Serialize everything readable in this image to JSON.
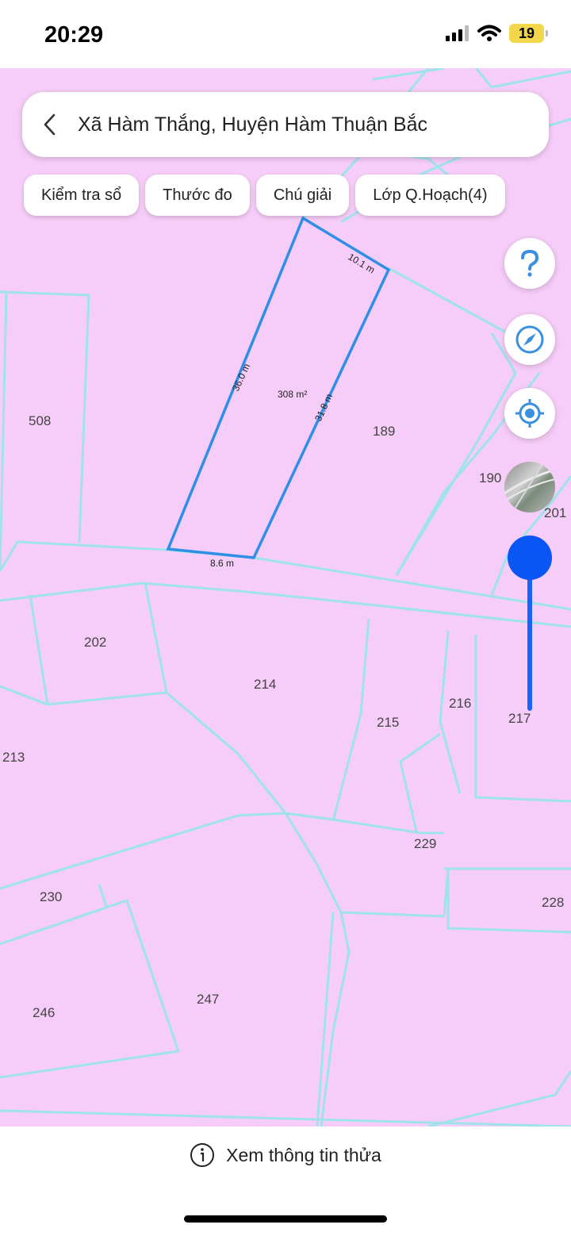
{
  "status": {
    "time": "20:29",
    "battery": "19"
  },
  "search": {
    "title": "Xã Hàm Thắng, Huyện Hàm Thuận Bắc"
  },
  "chips": [
    "Kiểm tra sổ",
    "Thước đo",
    "Chú giải",
    "Lớp Q.Hoạch(4)"
  ],
  "selected_parcel": {
    "area": "308 m²",
    "edges": [
      "10.1 m",
      "31.8 m",
      "8.6 m",
      "36.0 m"
    ]
  },
  "plots": [
    "508",
    "189",
    "190",
    "201",
    "202",
    "214",
    "216",
    "215",
    "217",
    "213",
    "229",
    "230",
    "228",
    "246",
    "247"
  ],
  "bottom": {
    "info_label": "Xem thông tin thửa"
  },
  "icons": [
    "back-icon",
    "help-icon",
    "compass-icon",
    "locate-icon",
    "satellite-layer-icon",
    "info-icon"
  ],
  "colors": {
    "map_fill": "#f6cdf8",
    "parcel_lines": "#9fe3ea",
    "selected_outline": "#2f8fe6",
    "accent": "#1a63f5"
  }
}
